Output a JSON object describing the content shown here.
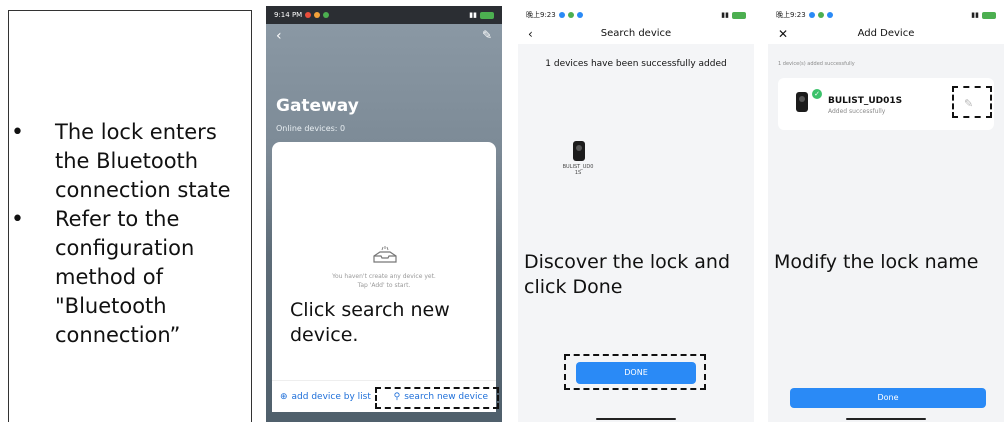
{
  "instructions": {
    "bullets": [
      "The lock enters\nthe Bluetooth\nconnection state",
      "Refer to the\nconfiguration\nmethod of\n\"Bluetooth\nconnection”"
    ],
    "bullet_char": "•"
  },
  "phone1": {
    "status_time": "9:14 PM",
    "title": "Gateway",
    "online_devices": "Online devices: 0",
    "empty_line1": "You haven't create any device yet.",
    "empty_line2": "Tap 'Add' to start.",
    "add_by_list_label": "add device by list",
    "search_new_label": "search new device",
    "caption": "Click search new\n device."
  },
  "phone2": {
    "status_time": "晚上9:23",
    "header_title": "Search device",
    "back_icon": "back-chevron-icon",
    "added_message": "1 devices have been successfully added",
    "device_label": "BULIST_UD0\n1S",
    "done_label": "DONE",
    "caption": "Discover the lock and\nclick Done"
  },
  "phone3": {
    "status_time": "晚上9:23",
    "header_title": "Add Device",
    "close_icon": "close-icon",
    "added_note": "1 device(s) added successfully",
    "device_name": "BULIST_UD01S",
    "device_status": "Added successfully",
    "done_label": "Done",
    "caption": "Modify the lock name"
  },
  "colors": {
    "accent_blue": "#2a8af6",
    "success_green": "#3cc26b",
    "gateway_bg": "#7c8a96"
  }
}
